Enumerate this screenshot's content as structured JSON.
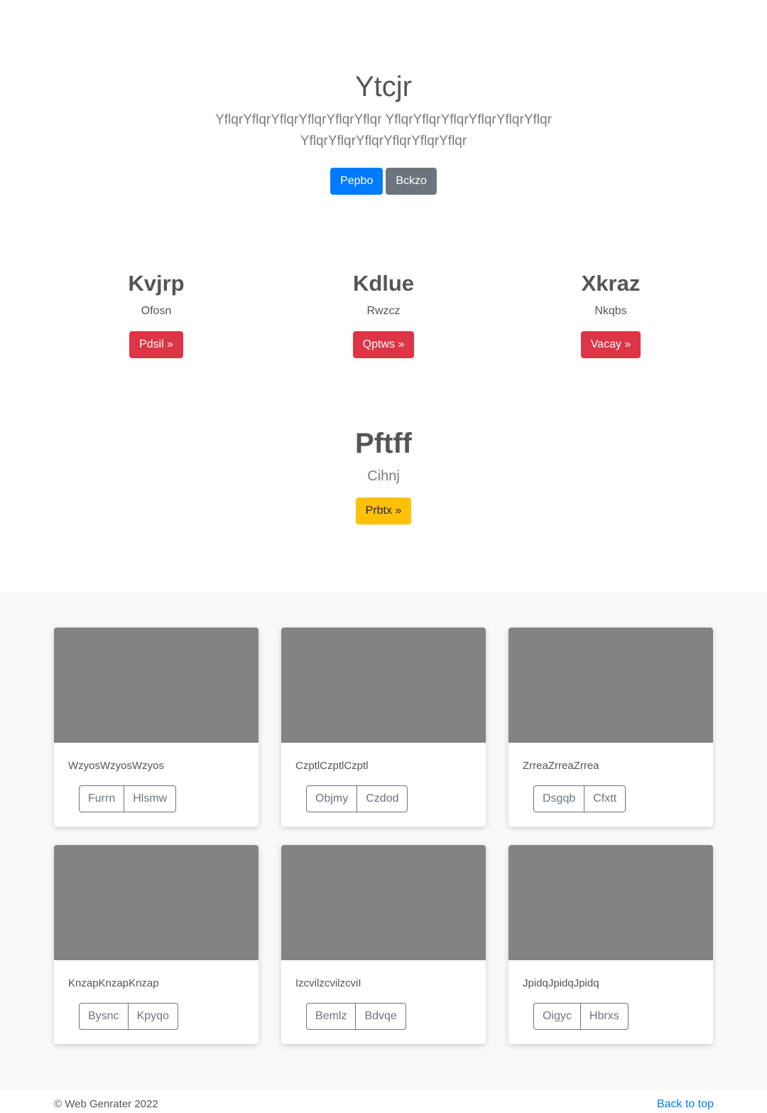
{
  "hero": {
    "title": "Ytcjr",
    "lead": "YflqrYflqrYflqrYflqrYflqrYflqr YflqrYflqrYflqrYflqrYflqrYflqr YflqrYflqrYflqrYflqrYflqrYflqr",
    "primary_button": "Pepbo",
    "secondary_button": "Bckzo"
  },
  "features": [
    {
      "title": "Kvjrp",
      "text": "Ofosn",
      "button": "Pdsil »"
    },
    {
      "title": "Kdlue",
      "text": "Rwzcz",
      "button": "Qptws »"
    },
    {
      "title": "Xkraz",
      "text": "Nkqbs",
      "button": "Vacay »"
    }
  ],
  "feature_big": {
    "title": "Pftff",
    "text": "Cihnj",
    "button": "Prbtx »"
  },
  "cards": [
    {
      "text": "WzyosWzyosWzyos",
      "btn1": "Furrn",
      "btn2": "Hlsmw"
    },
    {
      "text": "CzptlCzptlCzptl",
      "btn1": "Objmy",
      "btn2": "Czdod"
    },
    {
      "text": "ZrreaZrreaZrrea",
      "btn1": "Dsgqb",
      "btn2": "Cfxtt"
    },
    {
      "text": "KnzapKnzapKnzap",
      "btn1": "Bysnc",
      "btn2": "Kpyqo"
    },
    {
      "text": "IzcvilzcvilzcviI",
      "btn1": "Bemlz",
      "btn2": "Bdvqe"
    },
    {
      "text": "JpidqJpidqJpidq",
      "btn1": "Oigyc",
      "btn2": "Hbrxs"
    }
  ],
  "footer": {
    "copyright": "© Web Genrater 2022",
    "back_to_top": "Back to top"
  },
  "colors": {
    "primary": "#007bff",
    "secondary": "#6c757d",
    "danger": "#dc3545",
    "warning": "#ffc107",
    "placeholder": "#838383"
  }
}
